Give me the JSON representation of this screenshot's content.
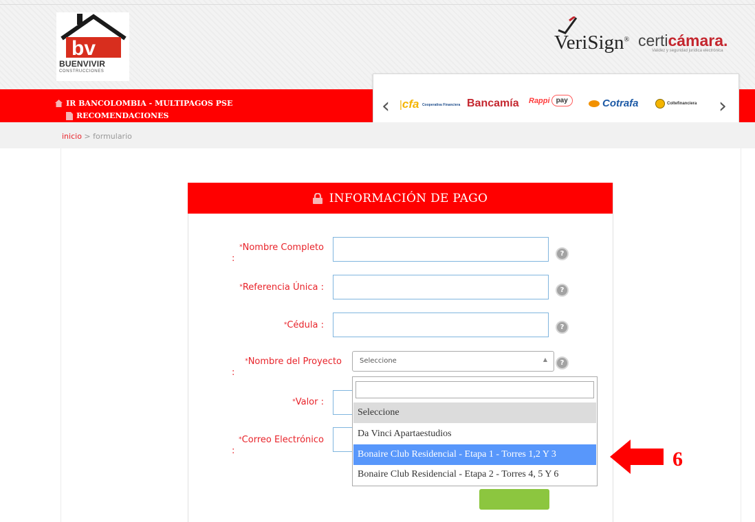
{
  "header": {
    "brand": {
      "monogram": "bv",
      "name": "BUENVIVIR",
      "subtitle": "CONSTRUCCIONES"
    },
    "verisign": {
      "text": "VeriSign",
      "trademark": "®"
    },
    "certicamara": {
      "prefix": "certi",
      "highlight": "cámara",
      "suffix": ".",
      "tagline": "Validez y seguridad jurídica electrónica"
    }
  },
  "nav": {
    "items": [
      {
        "label": "IR BANCOLOMBIA - MULTIPAGOS PSE",
        "icon": "home-icon"
      },
      {
        "label": "RECOMENDACIONES",
        "icon": "document-icon"
      }
    ],
    "background": "#ff0000"
  },
  "carousel": {
    "prev_icon": "chevron-left-icon",
    "next_icon": "chevron-right-icon",
    "logos": [
      {
        "name": "cfa",
        "text": "cfa",
        "extra": "Cooperativa Financiera"
      },
      {
        "name": "bancamia",
        "text": "Bancamía"
      },
      {
        "name": "rappipay",
        "text": "Rappi",
        "extra": "pay"
      },
      {
        "name": "cotrafa",
        "text": "Cotrafa"
      },
      {
        "name": "coltefinanciera",
        "text": "Coltefinanciera"
      }
    ]
  },
  "breadcrumb": {
    "home": "inicio",
    "separator": ">",
    "current": "formulario"
  },
  "form": {
    "title": "INFORMACIÓN DE PAGO",
    "fields": {
      "nombre": {
        "label": "Nombre Completo",
        "value": ""
      },
      "referencia": {
        "label": "Referencia Única :",
        "value": ""
      },
      "cedula": {
        "label": "Cédula :",
        "value": ""
      },
      "proyecto": {
        "label": "Nombre del Proyecto",
        "selected": "Seleccione"
      },
      "valor": {
        "label": "Valor :",
        "value": ""
      },
      "correo": {
        "label": "Correo Electrónico",
        "value": ""
      }
    },
    "required_mark": "*",
    "colon": ":",
    "help_icon": "?",
    "dropdown": {
      "search_value": "",
      "options": [
        "Seleccione",
        "Da Vinci Apartaestudios",
        "Bonaire Club Residencial - Etapa 1 - Torres 1,2 Y 3",
        "Bonaire Club Residencial - Etapa 2 - Torres 4, 5 Y 6"
      ],
      "highlighted_index": 2
    }
  },
  "annotation": {
    "number": "6",
    "color": "#ff0000"
  },
  "colors": {
    "accent_red": "#ff0000",
    "label_red": "#e8232a",
    "highlight_blue": "#5897fb",
    "input_border": "#7fb5de"
  }
}
